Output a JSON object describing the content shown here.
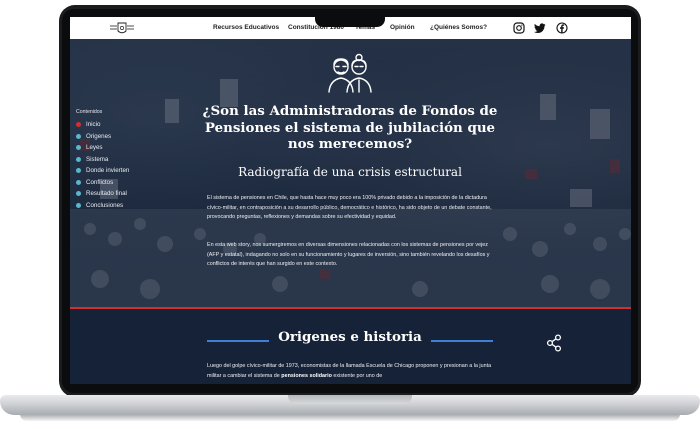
{
  "nav": {
    "links": [
      "Recursos Educativos",
      "Constitución 1980",
      "Temas",
      "Opinión",
      "¿Quiénes Somos?"
    ]
  },
  "social": {
    "icons": [
      "instagram-icon",
      "twitter-icon",
      "facebook-icon"
    ]
  },
  "toc": {
    "title": "Contenidos",
    "items": [
      "Inicio",
      "Origenes",
      "Leyes",
      "Sistema",
      "Donde invierten",
      "Conflictos",
      "Resultado final",
      "Conclusiones"
    ],
    "active_index": 0
  },
  "hero": {
    "title": "¿Son las Administradoras de Fondos de Pensiones el sistema de jubilación que nos merecemos?",
    "subtitle": "Radiografía de una crisis estructural",
    "paragraph1": "El sistema de pensiones en Chile, que hasta hace muy poco era 100% privado debido a la imposición de la dictadura cívico-militar, en contraposición a su desarrollo público, democrático e histórico, ha sido objeto de un debate constante, provocando preguntas, reflexiones y demandas sobre su efectividad y equidad.",
    "paragraph2": "En esta web story, nos sumergiremos en diversas dimensiones relacionadas con los sistemas de pensiones por vejez (AFP y estatal), indagando no solo en su funcionamiento y lugares de inversión, sino también revelando los desafíos y conflictos de interés que han surgido en este contexto."
  },
  "section": {
    "title": "Origenes e historia",
    "text_a": "Luego del golpe cívico-militar de 1973, economistas de la llamada Escuela de Chicago proponen y presionan a la junta militar a cambiar el sistema de ",
    "text_bold": "pensiones solidario",
    "text_b": " existente por uno de"
  },
  "colors": {
    "accent_red": "#d32f2f",
    "accent_blue": "#3f7fd6",
    "navy": "#152238",
    "toc_dot": "#5bb6c9"
  }
}
